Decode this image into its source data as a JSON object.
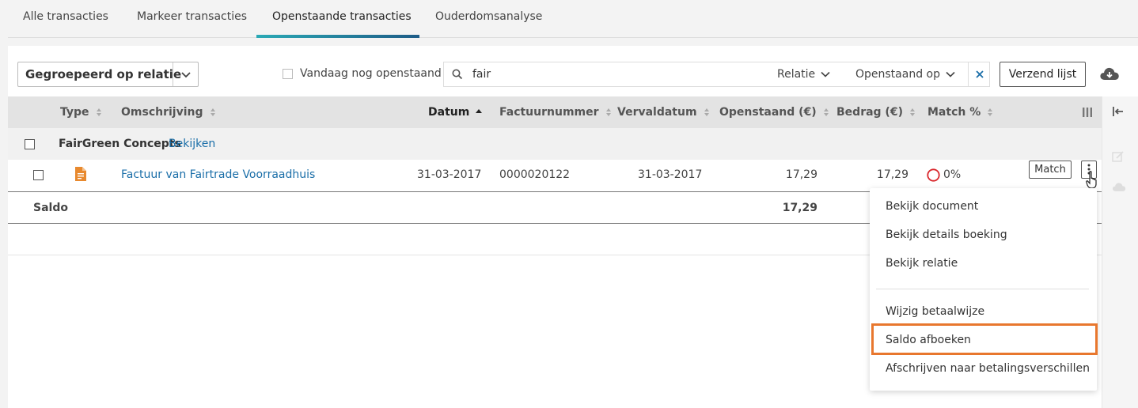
{
  "tabs": [
    {
      "label": "Alle transacties"
    },
    {
      "label": "Markeer transacties"
    },
    {
      "label": "Openstaande transacties",
      "active": true
    },
    {
      "label": "Ouderdomsanalyse"
    }
  ],
  "toolbar": {
    "group_by": "Gegroepeerd op relatie",
    "today_open_label": "Vandaag nog openstaand",
    "search_value": "fair",
    "filter_relation": "Relatie",
    "filter_open_on": "Openstaand op",
    "send_list": "Verzend lijst"
  },
  "table": {
    "headers": {
      "type": "Type",
      "description": "Omschrijving",
      "date": "Datum",
      "invoice_number": "Factuurnummer",
      "due_date": "Vervaldatum",
      "outstanding": "Openstaand (€)",
      "amount": "Bedrag (€)",
      "match_pct": "Match %"
    },
    "group": {
      "name": "FairGreen Concepts",
      "link": "Bekijken"
    },
    "rows": [
      {
        "description": "Factuur van Fairtrade Voorraadhuis",
        "date": "31-03-2017",
        "invoice_number": "0000020122",
        "due_date": "31-03-2017",
        "outstanding": "17,29",
        "amount": "17,29",
        "match_pct": "0%",
        "match_button": "Match"
      }
    ],
    "saldo_label": "Saldo",
    "saldo_value": "17,29"
  },
  "menu": {
    "items": [
      "Bekijk document",
      "Bekijk details boeking",
      "Bekijk relatie",
      "Wijzig betaalwijze",
      "Saldo afboeken",
      "Afschrijven naar betalingsverschillen"
    ],
    "highlighted": "Saldo afboeken"
  },
  "colors": {
    "accent_gradient_start": "#2aa9b5",
    "accent_gradient_end": "#1e5c87",
    "link": "#1a6ea8",
    "highlight": "#e8772e",
    "match_circle": "#d9262b",
    "doc_icon": "#e8892e"
  }
}
